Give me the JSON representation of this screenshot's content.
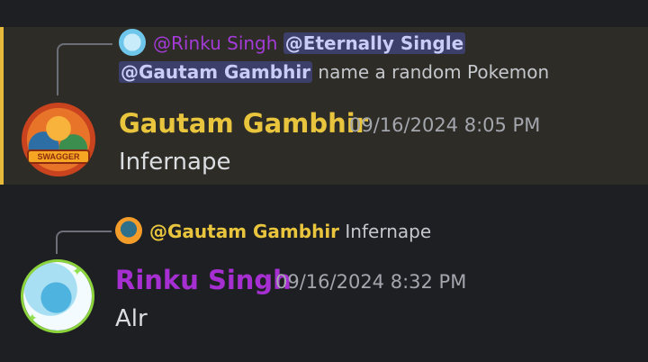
{
  "messages": [
    {
      "reply": {
        "author": "@Rinku Singh",
        "mentions": [
          "@Eternally Single",
          "@Gautam Gambhir"
        ],
        "text": "name a random Pokemon"
      },
      "author": "Gautam Gambhir",
      "timestamp": "09/16/2024 8:05 PM",
      "content": "Infernape",
      "avatar_banner": "SWAGGER",
      "highlighted": true,
      "highlight_color": "#e6b93a",
      "author_color": "#e9c53e"
    },
    {
      "reply": {
        "author": "@Gautam Gambhir",
        "text": "Infernape"
      },
      "author": "Rinku Singh",
      "timestamp": "09/16/2024 8:32 PM",
      "content": "Alr",
      "highlighted": false,
      "author_color": "#a52fd0"
    }
  ]
}
